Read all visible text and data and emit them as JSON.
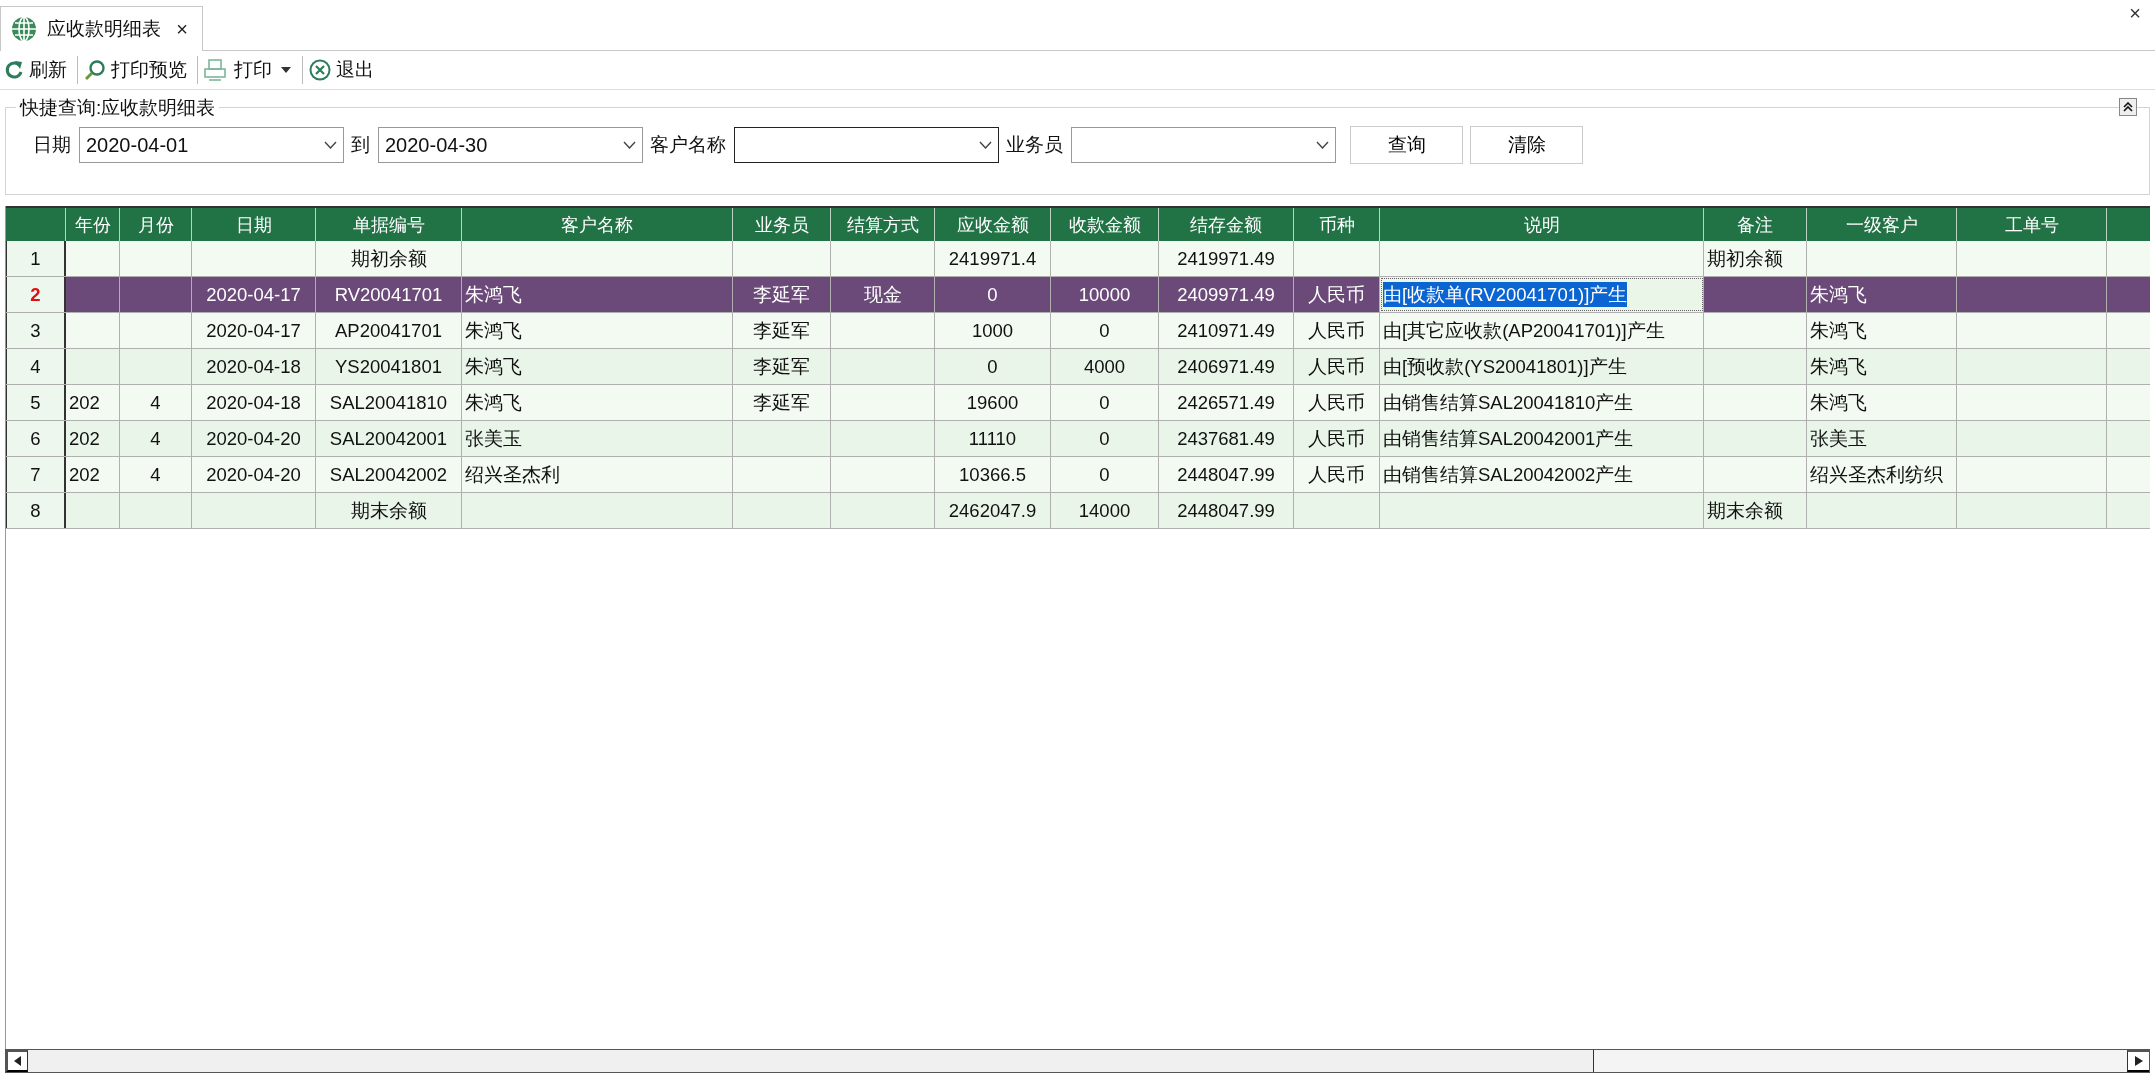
{
  "window": {
    "tab": {
      "title": "应收款明细表",
      "close": "×"
    },
    "close": "×"
  },
  "toolbar": [
    {
      "label": "刷新",
      "kind": "button"
    },
    {
      "label": "打印预览",
      "kind": "button"
    },
    {
      "label": "打印",
      "kind": "dropdown"
    },
    {
      "label": "退出",
      "kind": "button"
    }
  ],
  "query": {
    "title": "快捷查询:应收款明细表",
    "fields": [
      {
        "label": "日期",
        "value": "2020-04-01",
        "focused": false
      },
      {
        "label": "到",
        "value": "2020-04-30",
        "focused": false
      },
      {
        "label": "客户名称",
        "focused": true
      },
      {
        "label": "业务员",
        "focused": false
      }
    ],
    "buttons": [
      "查询",
      "清除"
    ]
  },
  "table": {
    "columns": [
      "年份",
      "月份",
      "日期",
      "单据编号",
      "客户名称",
      "业务员",
      "结算方式",
      "应收金额",
      "收款金额",
      "结存金额",
      "币种",
      "说明",
      "备注",
      "一级客户",
      "工单号"
    ],
    "rows": [
      {
        "number": "1",
        "selected": false,
        "cells": [
          null,
          null,
          null,
          "期初余额",
          null,
          null,
          null,
          "2419971.4",
          null,
          "2419971.49",
          null,
          null,
          "期初余额",
          null,
          null
        ]
      },
      {
        "number": "2",
        "selected": true,
        "cells": [
          null,
          null,
          "2020-04-17",
          "RV20041701",
          "朱鸿飞",
          "李延军",
          "现金",
          "0",
          "10000",
          "2409971.49",
          "人民币",
          {
            "text": "由[收款单(RV20041701)]产生",
            "focused": true,
            "text_selected": true
          },
          null,
          "朱鸿飞",
          null
        ]
      },
      {
        "number": "3",
        "selected": false,
        "cells": [
          null,
          null,
          "2020-04-17",
          "AP20041701",
          "朱鸿飞",
          "李延军",
          null,
          "1000",
          "0",
          "2410971.49",
          "人民币",
          "由[其它应收款(AP20041701)]产生",
          null,
          "朱鸿飞",
          null
        ]
      },
      {
        "number": "4",
        "selected": false,
        "cells": [
          null,
          null,
          "2020-04-18",
          "YS20041801",
          "朱鸿飞",
          "李延军",
          null,
          "0",
          "4000",
          "2406971.49",
          "人民币",
          "由[预收款(YS20041801)]产生",
          null,
          "朱鸿飞",
          null
        ]
      },
      {
        "number": "5",
        "selected": false,
        "cells": [
          "202",
          "4",
          "2020-04-18",
          "SAL20041810",
          "朱鸿飞",
          "李延军",
          null,
          "19600",
          "0",
          "2426571.49",
          "人民币",
          "由销售结算SAL20041810产生",
          null,
          "朱鸿飞",
          null
        ]
      },
      {
        "number": "6",
        "selected": false,
        "cells": [
          "202",
          "4",
          "2020-04-20",
          "SAL20042001",
          "张美玉",
          null,
          null,
          "11110",
          "0",
          "2437681.49",
          "人民币",
          "由销售结算SAL20042001产生",
          null,
          "张美玉",
          null
        ]
      },
      {
        "number": "7",
        "selected": false,
        "cells": [
          "202",
          "4",
          "2020-04-20",
          "SAL20042002",
          "绍兴圣杰利",
          null,
          null,
          "10366.5",
          "0",
          "2448047.99",
          "人民币",
          "由销售结算SAL20042002产生",
          null,
          "绍兴圣杰利纺织",
          null
        ]
      },
      {
        "number": "8",
        "selected": false,
        "cells": [
          null,
          null,
          null,
          "期末余额",
          null,
          null,
          null,
          "2462047.9",
          "14000",
          "2448047.99",
          null,
          null,
          "期末余额",
          null,
          null
        ]
      }
    ]
  }
}
